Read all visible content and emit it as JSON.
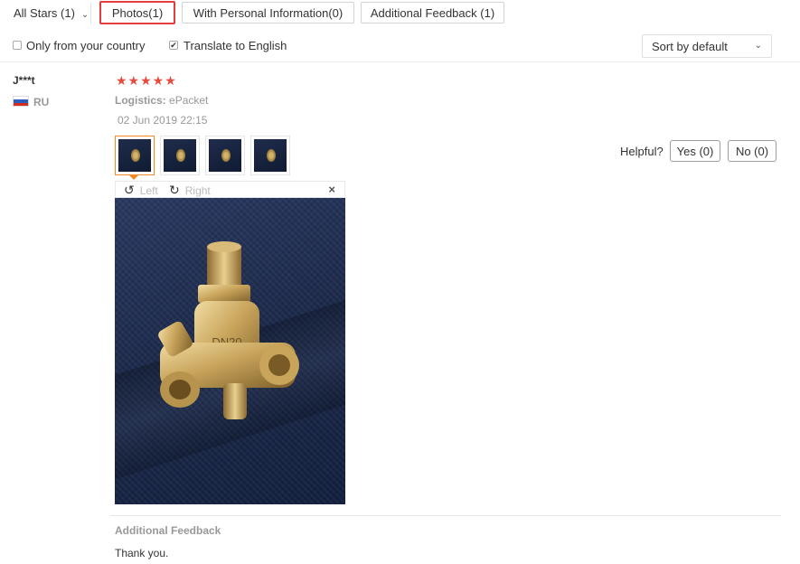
{
  "filters": {
    "stars_label": "All Stars (1)",
    "tabs": [
      {
        "label": "Photos(1)",
        "active": true
      },
      {
        "label": "With Personal Information(0)",
        "active": false
      },
      {
        "label": "Additional Feedback (1)",
        "active": false
      }
    ]
  },
  "options": {
    "only_country": {
      "label": "Only from your country",
      "checked": false
    },
    "translate": {
      "label": "Translate to English",
      "checked": true
    },
    "sort": {
      "selected": "Sort by default"
    }
  },
  "review": {
    "user": "J***t",
    "country": "RU",
    "rating": 5,
    "stars_text": "★★★★★",
    "logistics_label": "Logistics:",
    "logistics_value": "ePacket",
    "date": "02 Jun 2019 22:15",
    "helpful_label": "Helpful?",
    "yes_label": "Yes (0)",
    "no_label": "No (0)",
    "viewer": {
      "left_label": "Left",
      "right_label": "Right",
      "close_glyph": "×"
    },
    "additional_feedback_title": "Additional Feedback",
    "additional_feedback_text": "Thank you."
  },
  "colors": {
    "accent": "#e43b3b",
    "star": "#e64b3d",
    "thumb_selected": "#f08a24"
  },
  "icons": {
    "rotate_left": "rotate-left-icon",
    "rotate_right": "rotate-right-icon",
    "close": "close-icon"
  }
}
